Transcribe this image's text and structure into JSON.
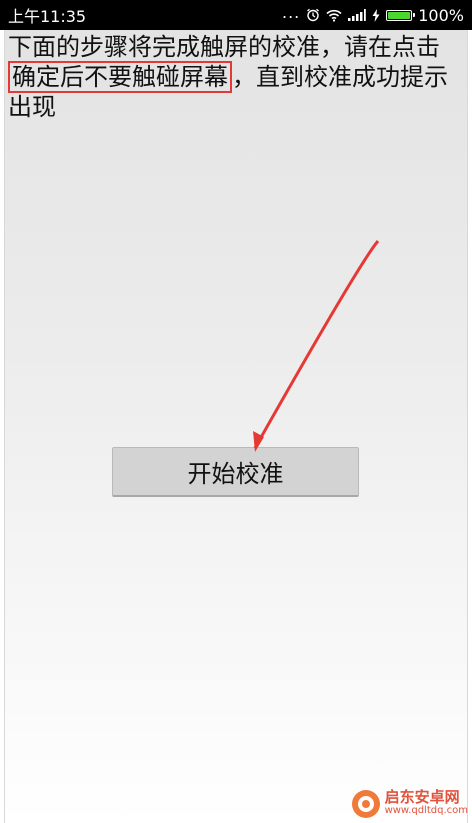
{
  "status_bar": {
    "time": "上午11:35",
    "dots": "...",
    "battery_percent": "100%",
    "battery_level": 1.0,
    "icons": [
      "alarm-icon",
      "wifi-icon",
      "signal-icon",
      "charging-icon",
      "battery-icon"
    ]
  },
  "instruction": {
    "before": "下面的步骤将完成触屏的校准，请在点击",
    "highlight": "确定后不要触碰屏幕",
    "after": "，直到校准成功提示出现"
  },
  "start_button": {
    "label": "开始校准"
  },
  "colors": {
    "highlight_border": "#e53935",
    "arrow": "#e53935",
    "battery": "#4cd630",
    "button_bg": "#d3d3d3"
  },
  "watermark": {
    "title": "启东安卓网",
    "url": "www.qdltdq.com"
  }
}
